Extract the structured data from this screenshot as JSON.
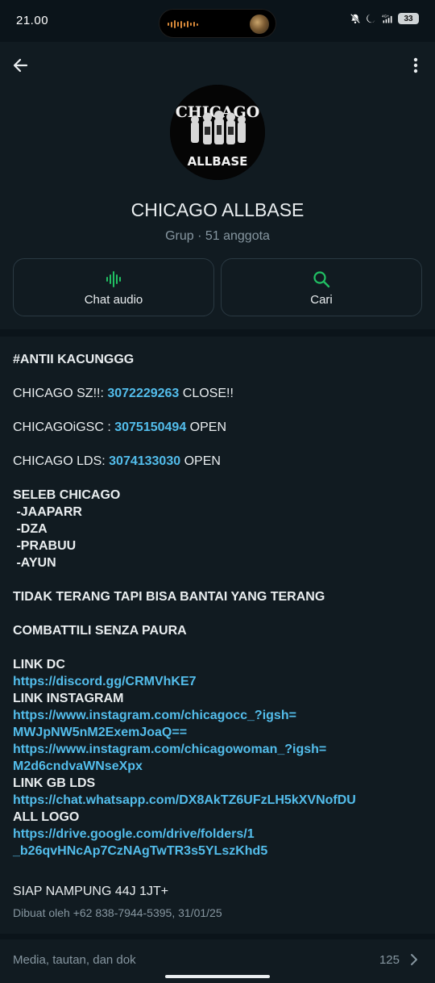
{
  "status_bar": {
    "time": "21.00",
    "network": "4G+",
    "battery": "33"
  },
  "header": {
    "group_name": "CHICAGO ALLBASE",
    "group_meta": "Grup · 51 anggota",
    "avatar_text_top": "CHICAGO",
    "avatar_text_bottom": "ALLBASE",
    "actions": [
      {
        "label": "Chat audio",
        "icon": "audio-wave-icon"
      },
      {
        "label": "Cari",
        "icon": "search-icon"
      }
    ]
  },
  "description": {
    "heading": "#ANTII KACUNGGG",
    "lines": [
      {
        "prefix": "CHICAGO SZ!!: ",
        "number": "3072229263",
        "suffix": " CLOSE!!"
      },
      {
        "prefix": "CHICAGOiGSC : ",
        "number": "3075150494",
        "suffix": " OPEN"
      },
      {
        "prefix": "CHICAGO LDS: ",
        "number": "3074133030",
        "suffix": " OPEN"
      }
    ],
    "seleb_title": "SELEB CHICAGO",
    "seleb_members": [
      " -JAAPARR",
      " -DZA",
      " -PRABUU",
      " -AYUN"
    ],
    "slogan_1": "TIDAK TERANG TAPI BISA BANTAI YANG TERANG",
    "slogan_2": "COMBATTILI SENZA PAURA",
    "link_dc_title": "LINK DC",
    "link_dc": "https://discord.gg/CRMVhKE7",
    "link_ig_title": "LINK INSTAGRAM",
    "link_ig_1a": "https://www.instagram.com/chicagocc_?igsh=",
    "link_ig_1b": "MWJpNW5nM2ExemJoaQ==",
    "link_ig_2a": "https://www.instagram.com/chicagowoman_?igsh=",
    "link_ig_2b": "M2d6cndvaWNseXpx",
    "link_gb_title": "LINK GB LDS",
    "link_gb": "https://chat.whatsapp.com/DX8AkTZ6UFzLH5kXVNofDU",
    "all_logo_title": "ALL LOGO",
    "link_logo_a": "https://drive.google.com/drive/folders/1",
    "link_logo_b": "_b26qvHNcAp7CzNAgTwTR3s5YLszKhd5",
    "footer_line": "SIAP NAMPUNG 44J 1JT+",
    "created_by": "Dibuat oleh +62 838-7944-5395, 31/01/25"
  },
  "media": {
    "label": "Media, tautan, dan dok",
    "count": "125"
  },
  "colors": {
    "background": "#0b141a",
    "panel": "#111b21",
    "link": "#53bdeb",
    "accent_green": "#21c063",
    "muted": "#8696a0"
  }
}
